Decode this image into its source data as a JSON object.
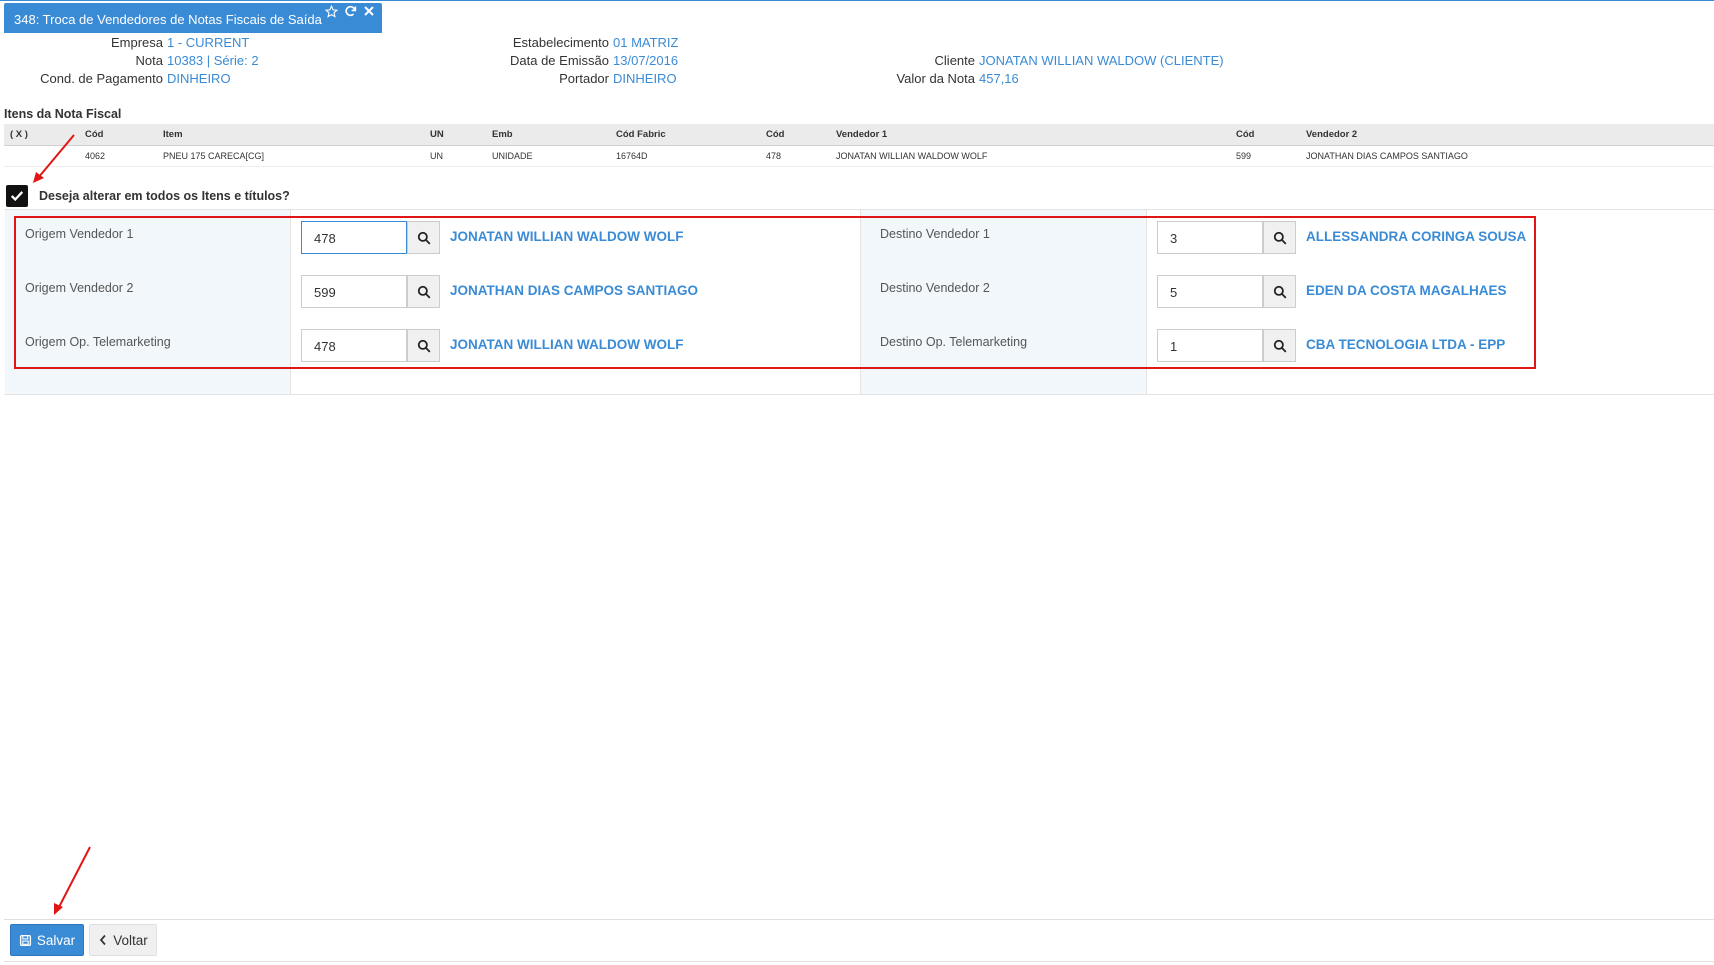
{
  "tab": {
    "title": "348: Troca de Vendedores de Notas Fiscais de Saída",
    "icons": [
      "star-outline-icon",
      "refresh-icon",
      "close-icon"
    ]
  },
  "header": {
    "empresa_label": "Empresa",
    "empresa_value": "1 - CURRENT",
    "nota_label": "Nota",
    "nota_value": "10383 | Série: 2",
    "cond_label": "Cond. de Pagamento",
    "cond_value": "DINHEIRO",
    "estab_label": "Estabelecimento",
    "estab_value": "01 MATRIZ",
    "emissao_label": "Data de Emissão",
    "emissao_value": "13/07/2016",
    "portador_label": "Portador",
    "portador_value": "DINHEIRO",
    "cliente_label": "Cliente",
    "cliente_value": "JONATAN WILLIAN WALDOW (CLIENTE)",
    "valor_label": "Valor da Nota",
    "valor_value": "457,16"
  },
  "items": {
    "title": "Itens da Nota Fiscal",
    "columns": [
      "( X )",
      "Cód",
      "Item",
      "UN",
      "Emb",
      "Cód Fabric",
      "Cód",
      "Vendedor 1",
      "Cód",
      "Vendedor 2"
    ],
    "rows": [
      [
        "",
        "4062",
        "PNEU 175 CARECA[CG]",
        "UN",
        "UNIDADE",
        "16764D",
        "478",
        "JONATAN WILLIAN WALDOW WOLF",
        "599",
        "JONATHAN DIAS CAMPOS SANTIAGO"
      ]
    ]
  },
  "checkbox": {
    "label": "Deseja alterar em todos os Itens e títulos?",
    "checked": true
  },
  "form": {
    "origem_vendedor1_label": "Origem Vendedor 1",
    "origem_vendedor1_code": "478",
    "origem_vendedor1_name": "JONATAN WILLIAN WALDOW WOLF",
    "origem_vendedor2_label": "Origem Vendedor 2",
    "origem_vendedor2_code": "599",
    "origem_vendedor2_name": "JONATHAN DIAS CAMPOS SANTIAGO",
    "origem_tele_label": "Origem Op. Telemarketing",
    "origem_tele_code": "478",
    "origem_tele_name": "JONATAN WILLIAN WALDOW WOLF",
    "destino_vendedor1_label": "Destino Vendedor 1",
    "destino_vendedor1_code": "3",
    "destino_vendedor1_name": "ALLESSANDRA CORINGA SOUSA",
    "destino_vendedor2_label": "Destino Vendedor 2",
    "destino_vendedor2_code": "5",
    "destino_vendedor2_name": "EDEN DA COSTA MAGALHAES",
    "destino_tele_label": "Destino Op. Telemarketing",
    "destino_tele_code": "1",
    "destino_tele_name": "CBA TECNOLOGIA LTDA - EPP"
  },
  "footer": {
    "save_label": "Salvar",
    "back_label": "Voltar"
  },
  "colors": {
    "accent": "#3a8bd6",
    "highlight_box": "#e01616"
  }
}
